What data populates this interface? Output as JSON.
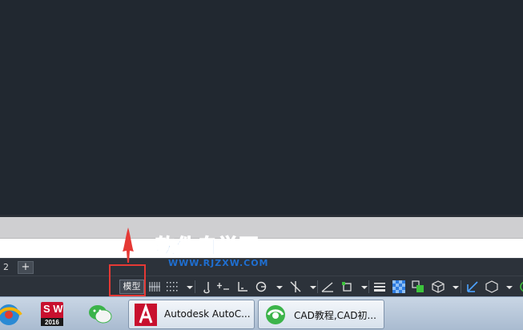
{
  "layout_tabs": {
    "partial_tab_label": "2",
    "add_tab_label": "+"
  },
  "statusbar": {
    "model_label": "模型",
    "icons": [
      "grid-icon",
      "snap-icon",
      "dropdown-arrow-icon",
      "infer-icon",
      "dynamic-input-icon",
      "ortho-icon",
      "polar-icon",
      "isodraft-icon",
      "object-snap-tracking-icon",
      "osnap-icon",
      "lineweight-icon",
      "transparency-icon",
      "selection-cycling-icon",
      "3d-osnap-icon",
      "dynamic-ucs-icon",
      "annotation-scale-icon"
    ]
  },
  "watermark": {
    "title": "软件自学网",
    "url": "WWW.RJZXW.COM"
  },
  "taskbar": {
    "apps": [
      "browser-icon",
      "solidworks-2016-icon",
      "wechat-icon"
    ],
    "solidworks_badge_top": "S W",
    "solidworks_badge_year": "2016",
    "windows": [
      {
        "title": "Autodesk AutoC...",
        "icon": "autocad-icon"
      },
      {
        "title": "CAD教程,CAD初...",
        "icon": "browser-window-icon"
      }
    ]
  },
  "colors": {
    "drawing_bg": "#212830",
    "highlight": "#e53935",
    "watermark_blue": "#1f6fd1",
    "autocad_red": "#c8102e"
  }
}
